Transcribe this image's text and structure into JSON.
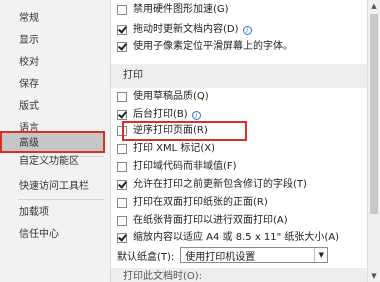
{
  "sidebar": {
    "items": [
      {
        "label": "常规"
      },
      {
        "label": "显示"
      },
      {
        "label": "校对"
      },
      {
        "label": "保存"
      },
      {
        "label": "版式"
      },
      {
        "label": "语言"
      },
      {
        "label": "高级"
      },
      {
        "label": "自定义功能区"
      },
      {
        "label": "快速访问工具栏"
      },
      {
        "label": "加载项"
      },
      {
        "label": "信任中心"
      }
    ],
    "selected": "高级"
  },
  "display_section": {
    "options": [
      {
        "label": "禁用硬件图形加速(G)",
        "checked": false
      },
      {
        "label": "拖动时更新文档内容(D)",
        "checked": true,
        "info": true
      },
      {
        "label": "使用子像素定位平滑屏幕上的字体。",
        "checked": true
      }
    ]
  },
  "print_section": {
    "header": "打印",
    "options": [
      {
        "label": "使用草稿品质(Q)",
        "checked": false
      },
      {
        "label": "后台打印(B)",
        "checked": true,
        "info": true
      },
      {
        "label": "逆序打印页面(R)",
        "checked": false
      },
      {
        "label": "打印 XML 标记(X)",
        "checked": false
      },
      {
        "label": "打印域代码而非域值(F)",
        "checked": false
      },
      {
        "label": "允许在打印之前更新包含修订的字段(T)",
        "checked": true
      },
      {
        "label": "打印在双面打印纸张的正面(R)",
        "checked": false
      },
      {
        "label": "在纸张背面打印以进行双面打印(A)",
        "checked": false
      },
      {
        "label": "缩放内容以适应 A4 或 8.5 x 11\" 纸张大小(A)",
        "checked": true
      }
    ],
    "default_tray_label": "默认纸盒(T):",
    "default_tray_value": "使用打印机设置",
    "cut_text": "打印此文档时(O):"
  },
  "info_icon_glyph": "i",
  "dropdown_glyph": "▼",
  "scroll_up_glyph": "▲",
  "scroll_down_glyph": "▼"
}
